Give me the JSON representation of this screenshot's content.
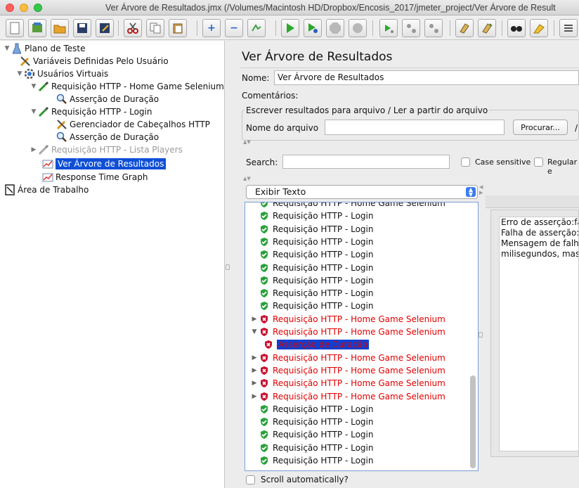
{
  "window": {
    "title": "Ver Árvore de Resultados.jmx (/Volumes/Macintosh HD/Dropbox/Encosis_2017/jmeter_project/Ver Árvore de Result"
  },
  "toolbar": {
    "buttons": [
      "new-icon",
      "templates-icon",
      "open-icon",
      "save-icon",
      "save-as-icon",
      "cut-icon",
      "copy-icon",
      "paste-icon",
      "expand-icon",
      "collapse-icon",
      "toggle-icon",
      "start-icon",
      "start-no-pauses-icon",
      "stop-icon",
      "shutdown-icon",
      "remote-start-icon",
      "remote-stop-icon",
      "remote-shutdown-icon",
      "clear-icon",
      "clear-all-icon",
      "search-icon",
      "reset-search-icon",
      "function-helper-icon"
    ]
  },
  "tree": {
    "nodes": [
      {
        "label": "Plano de Teste",
        "icon": "flask-icon",
        "expanded": true
      },
      {
        "label": "Variáveis Definidas Pelo Usuário",
        "icon": "wrench-icon"
      },
      {
        "label": "Usuários Virtuais",
        "icon": "gear-icon",
        "expanded": true
      },
      {
        "label": "Requisição HTTP - Home Game Selenium",
        "icon": "pipette-icon",
        "expanded": true
      },
      {
        "label": "Asserção de Duração",
        "icon": "magnifier-icon"
      },
      {
        "label": "Requisição HTTP - Login",
        "icon": "pipette-icon",
        "expanded": true
      },
      {
        "label": "Gerenciador de Cabeçalhos HTTP",
        "icon": "wrench-icon"
      },
      {
        "label": "Asserção de Duração",
        "icon": "magnifier-icon"
      },
      {
        "label": "Requisição HTTP - Lista Players",
        "icon": "pipette-icon",
        "collapsed": true,
        "disabled": true
      },
      {
        "label": "Ver Árvore de Resultados",
        "icon": "graph-icon",
        "selected": true
      },
      {
        "label": "Response Time Graph",
        "icon": "graph-icon"
      },
      {
        "label": "Área de Trabalho",
        "icon": "workbench-icon"
      }
    ]
  },
  "panel": {
    "title": "Ver Árvore de Resultados",
    "name_label": "Nome:",
    "name_value": "Ver Árvore de Resultados",
    "comments_label": "Comentários:",
    "file_group_label": "Escrever resultados para arquivo / Ler a partir do arquivo",
    "filename_label": "Nome do arquivo",
    "filename_value": "",
    "browse_button": "Procurar...",
    "browse_suffix": "/",
    "search_label": "Search:",
    "search_value": "",
    "case_sensitive_label": "Case sensitive",
    "regex_label": "Regular e",
    "renderer_selected": "Exibir Texto",
    "scroll_auto_label": "Scroll automatically?"
  },
  "results": [
    {
      "label": "Requisição HTTP - Home Game Selenium",
      "status": "success",
      "partial": true
    },
    {
      "label": "Requisição HTTP - Login",
      "status": "success"
    },
    {
      "label": "Requisição HTTP - Login",
      "status": "success"
    },
    {
      "label": "Requisição HTTP - Login",
      "status": "success"
    },
    {
      "label": "Requisição HTTP - Login",
      "status": "success"
    },
    {
      "label": "Requisição HTTP - Login",
      "status": "success"
    },
    {
      "label": "Requisição HTTP - Login",
      "status": "success"
    },
    {
      "label": "Requisição HTTP - Login",
      "status": "success"
    },
    {
      "label": "Requisição HTTP - Login",
      "status": "success"
    },
    {
      "label": "Requisição HTTP - Home Game Selenium",
      "status": "fail",
      "arrow": "right"
    },
    {
      "label": "Requisição HTTP - Home Game Selenium",
      "status": "fail",
      "arrow": "down"
    },
    {
      "label": "Asserção de Duração",
      "status": "fail",
      "child": true,
      "selected": true
    },
    {
      "label": "Requisição HTTP - Home Game Selenium",
      "status": "fail",
      "arrow": "right"
    },
    {
      "label": "Requisição HTTP - Home Game Selenium",
      "status": "fail",
      "arrow": "right"
    },
    {
      "label": "Requisição HTTP - Home Game Selenium",
      "status": "fail",
      "arrow": "right"
    },
    {
      "label": "Requisição HTTP - Home Game Selenium",
      "status": "fail",
      "arrow": "right"
    },
    {
      "label": "Requisição HTTP - Login",
      "status": "success"
    },
    {
      "label": "Requisição HTTP - Login",
      "status": "success"
    },
    {
      "label": "Requisição HTTP - Login",
      "status": "success"
    },
    {
      "label": "Requisição HTTP - Login",
      "status": "success"
    },
    {
      "label": "Requisição HTTP - Login",
      "status": "success"
    }
  ],
  "detail": {
    "lines": [
      "Erro de asserção:fa",
      "Falha de asserção:",
      "Mensagem de falh",
      "milisegundos, mas"
    ]
  },
  "colors": {
    "selection": "#0f4fd6",
    "fail_text": "#e00000",
    "success_icon": "#2aa13a",
    "fail_icon": "#c8102e"
  }
}
